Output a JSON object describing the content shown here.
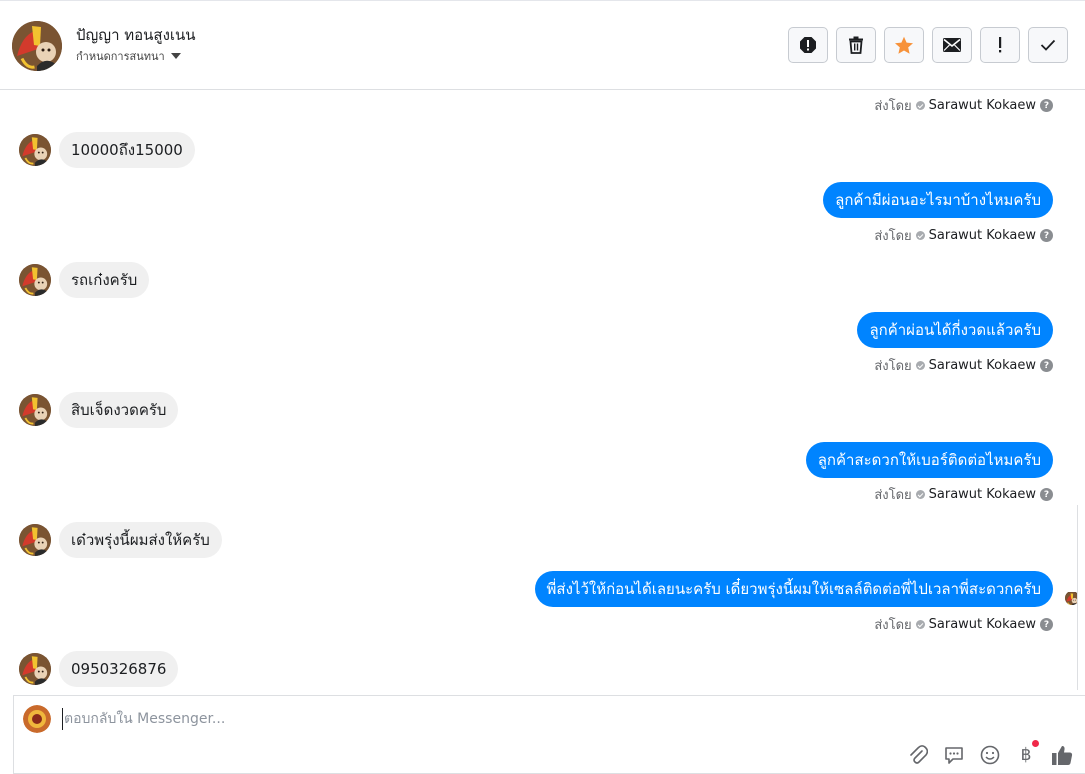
{
  "header": {
    "contact_name": "ปัญญา ทอนสูงเนน",
    "conversation_setting": "กำหนดการสนทนา",
    "toolbar": [
      {
        "name": "report-icon",
        "label": "Report"
      },
      {
        "name": "trash-icon",
        "label": "Delete"
      },
      {
        "name": "star-icon",
        "label": "Star"
      },
      {
        "name": "mail-icon",
        "label": "Mark unread"
      },
      {
        "name": "exclamation-icon",
        "label": "Important"
      },
      {
        "name": "check-icon",
        "label": "Done"
      }
    ]
  },
  "sent_by_prefix": "ส่งโดย",
  "agent_name": "Sarawut Kokaew",
  "messages": [
    {
      "direction": "in",
      "text": "10000ถึง15000"
    },
    {
      "direction": "out",
      "text": "ลูกค้ามีผ่อนอะไรมาบ้างไหมครับ"
    },
    {
      "direction": "in",
      "text": "รถเก๋งครับ"
    },
    {
      "direction": "out",
      "text": "ลูกค้าผ่อนได้กี่งวดแล้วครับ"
    },
    {
      "direction": "in",
      "text": "สิบเจ็ดงวดครับ"
    },
    {
      "direction": "out",
      "text": "ลูกค้าสะดวกให้เบอร์ติดต่อไหมครับ"
    },
    {
      "direction": "in",
      "text": "เด๋วพรุ่งนี้ผมส่งให้ครับ"
    },
    {
      "direction": "out",
      "text": "พี่ส่งไว้ให้ก่อนได้เลยนะครับ เดี๋ยวพรุ่งนี้ผมให้เซลล์ติดต่อพี่ไปเวลาพี่สะดวกครับ"
    },
    {
      "direction": "in",
      "text": "0950326876"
    }
  ],
  "composer": {
    "placeholder": "ตอบกลับใน Messenger...",
    "value": "",
    "icons": [
      "attach-icon",
      "saved-replies-icon",
      "emoji-icon",
      "baht-payment-icon",
      "like-icon"
    ],
    "baht_symbol": "฿"
  },
  "colors": {
    "outgoing_bubble": "#0084ff",
    "incoming_bubble": "#f0f0f0",
    "star": "#f7923a",
    "notification_dot": "#f02849"
  }
}
